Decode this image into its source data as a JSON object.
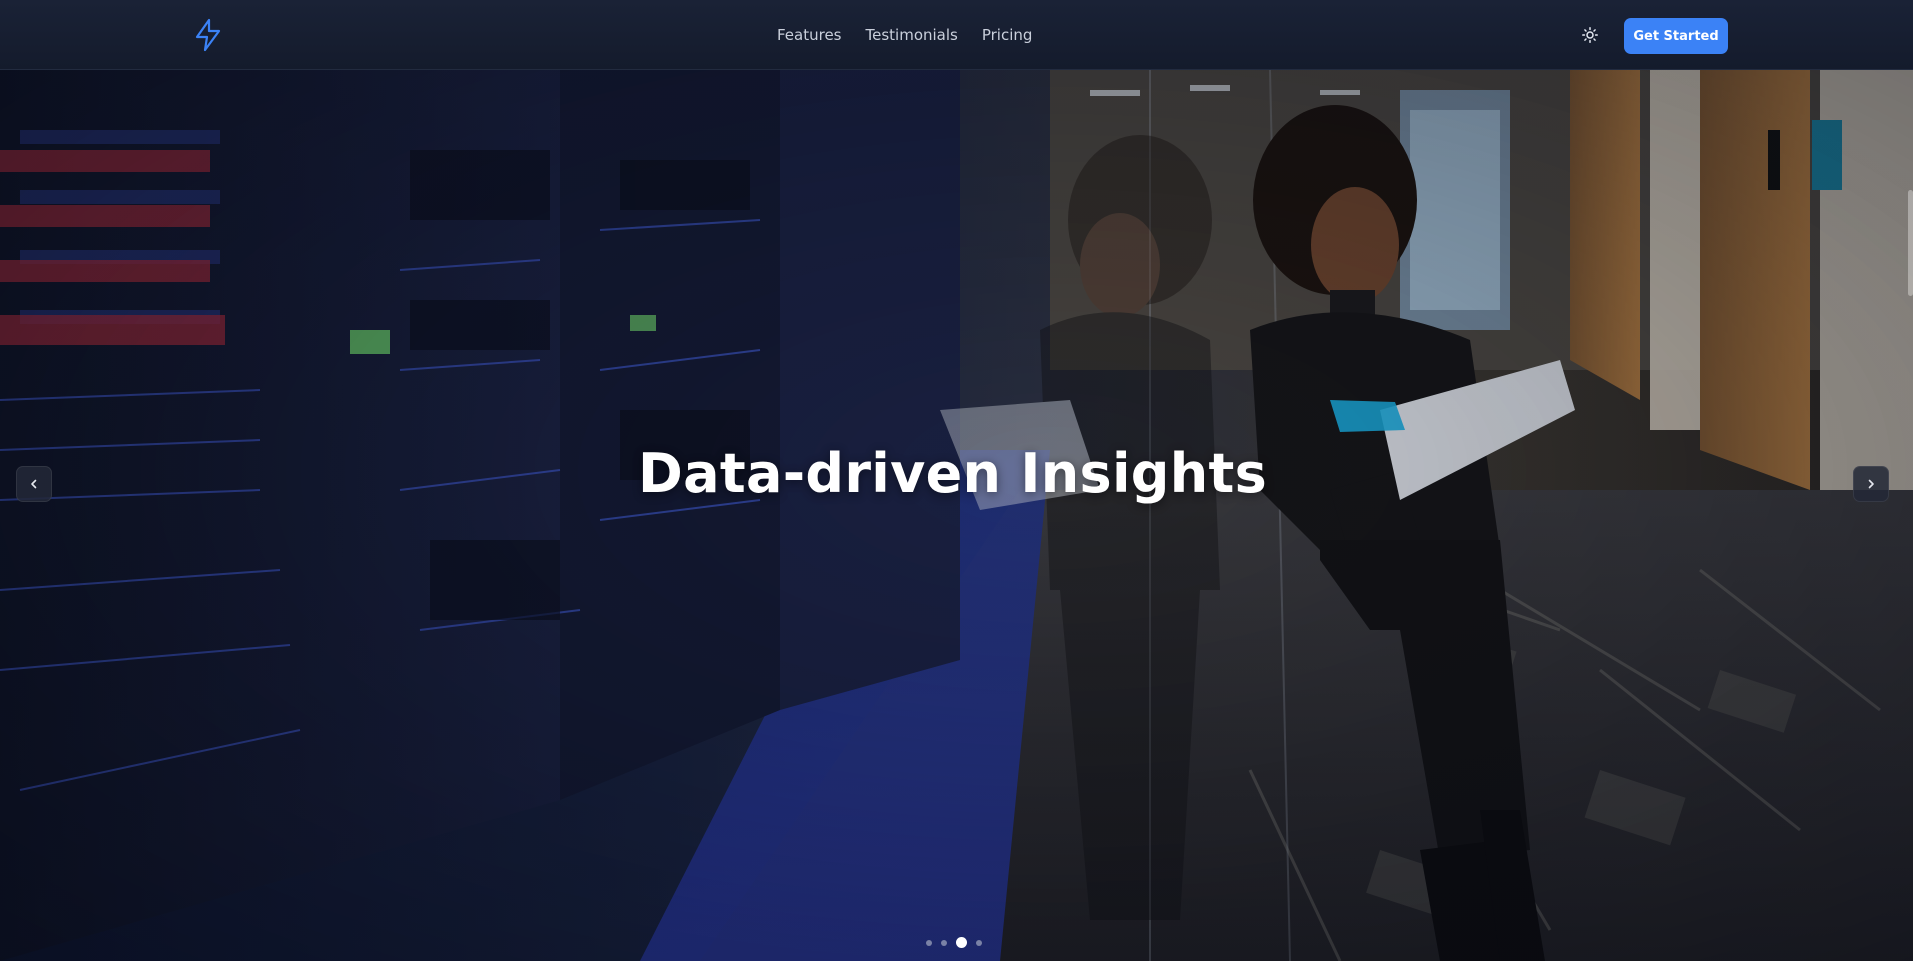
{
  "navbar": {
    "logo_icon": "lightning-bolt-icon",
    "links": [
      {
        "label": "Features"
      },
      {
        "label": "Testimonials"
      },
      {
        "label": "Pricing"
      }
    ],
    "theme_toggle_icon": "sun-icon",
    "cta_label": "Get Started"
  },
  "hero": {
    "title": "Data-driven Insights",
    "prev_icon": "chevron-left-icon",
    "next_icon": "chevron-right-icon",
    "slides": {
      "count": 4,
      "active_index": 2
    }
  },
  "colors": {
    "accent": "#3b82f6",
    "navbar_bg": "#161d2f",
    "hero_title": "#ffffff"
  }
}
